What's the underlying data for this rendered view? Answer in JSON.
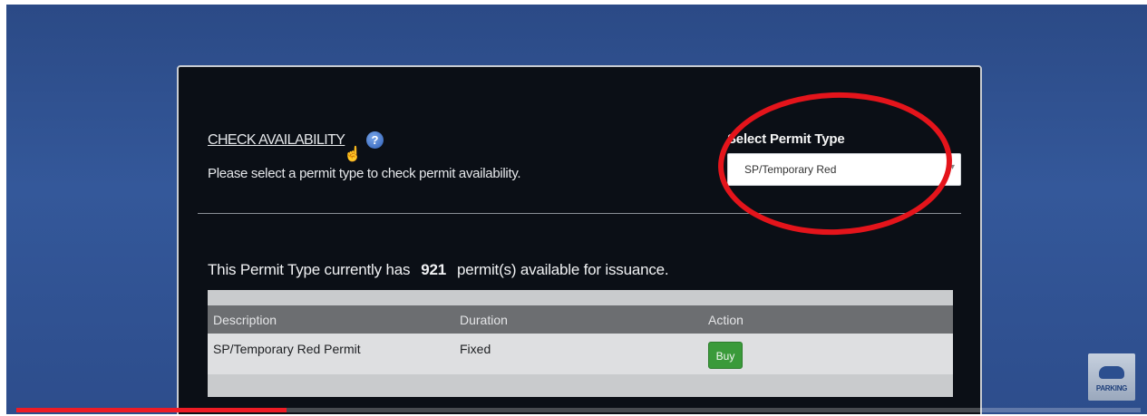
{
  "check_availability": {
    "link_label": "CHECK AVAILABILITY",
    "help_icon_glyph": "?",
    "instruction": "Please select a permit type to check permit availability."
  },
  "permit_type": {
    "label": "Select Permit Type",
    "selected": "SP/Temporary Red"
  },
  "availability": {
    "prefix": "This Permit Type currently has",
    "count": "921",
    "suffix": "permit(s) available for issuance."
  },
  "table": {
    "headers": [
      "Description",
      "Duration",
      "Action"
    ],
    "rows": [
      {
        "description": "SP/Temporary Red Permit",
        "duration": "Fixed",
        "action_label": "Buy"
      }
    ]
  },
  "annotation": {
    "color": "#e4141b",
    "shape": "ellipse-around-permit-type-select"
  },
  "badge": {
    "text": "PARKING"
  },
  "video_progress": {
    "fraction": 0.24,
    "color": "#ee1c25"
  },
  "colors": {
    "panel_bg": "#0b0f16",
    "page_bg": "#2e4f8e",
    "buy_button": "#3a9a3a",
    "table_header": "#6c6e71"
  }
}
